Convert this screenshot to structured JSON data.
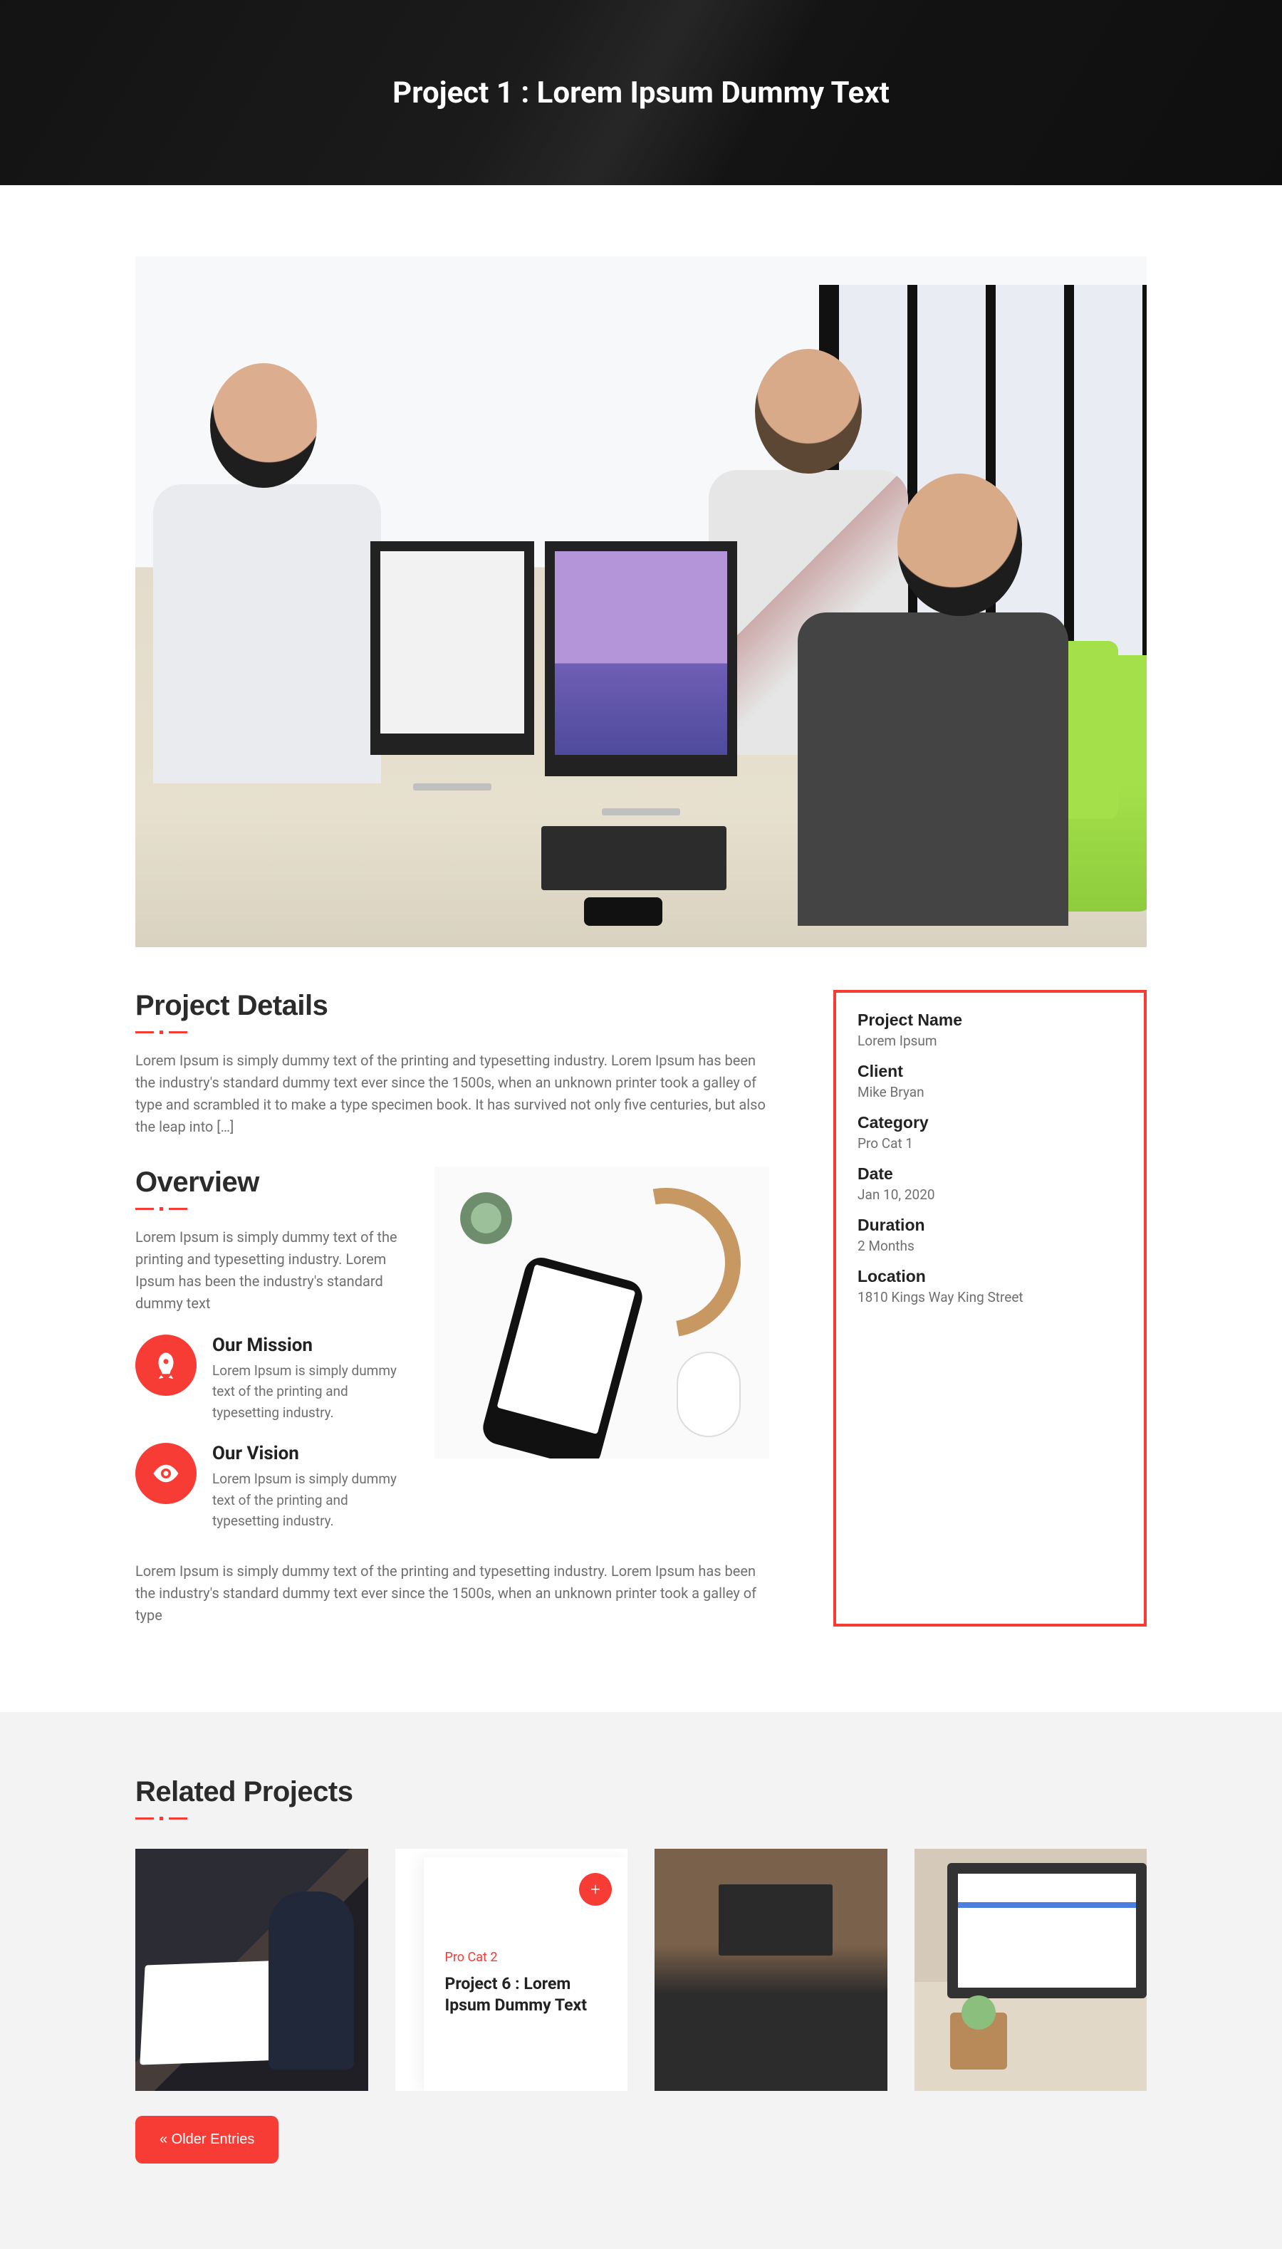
{
  "hero": {
    "title": "Project 1 : Lorem Ipsum Dummy Text"
  },
  "details": {
    "heading": "Project Details",
    "body": "Lorem Ipsum is simply dummy text of the printing and typesetting industry. Lorem Ipsum has been the industry's standard dummy text ever since the 1500s, when an unknown printer took a galley of type and scrambled it to make a type specimen book. It has survived not only five centuries, but also the leap into […]"
  },
  "overview": {
    "heading": "Overview",
    "intro": "Lorem Ipsum is simply dummy text of the printing and typesetting industry. Lorem Ipsum has been the industry's standard dummy text",
    "mission_title": "Our Mission",
    "mission_body": "Lorem Ipsum is simply dummy text of the printing and typesetting industry.",
    "vision_title": "Our Vision",
    "vision_body": "Lorem Ipsum is simply dummy text of the printing and typesetting industry.",
    "outro": "Lorem Ipsum is simply dummy text of the printing and typesetting industry. Lorem Ipsum has been the industry's standard dummy text ever since the 1500s, when an unknown printer took a galley of type"
  },
  "meta": {
    "name_label": "Project Name",
    "name": "Lorem Ipsum",
    "client_label": "Client",
    "client": "Mike Bryan",
    "category_label": "Category",
    "category": "Pro Cat 1",
    "date_label": "Date",
    "date": "Jan 10, 2020",
    "duration_label": "Duration",
    "duration": "2 Months",
    "location_label": "Location",
    "location": "1810 Kings Way King Street"
  },
  "related": {
    "heading": "Related Projects",
    "card_cat": "Pro Cat 2",
    "card_title": "Project 6 : Lorem Ipsum Dummy Text",
    "plus": "+",
    "older": "« Older Entries"
  }
}
